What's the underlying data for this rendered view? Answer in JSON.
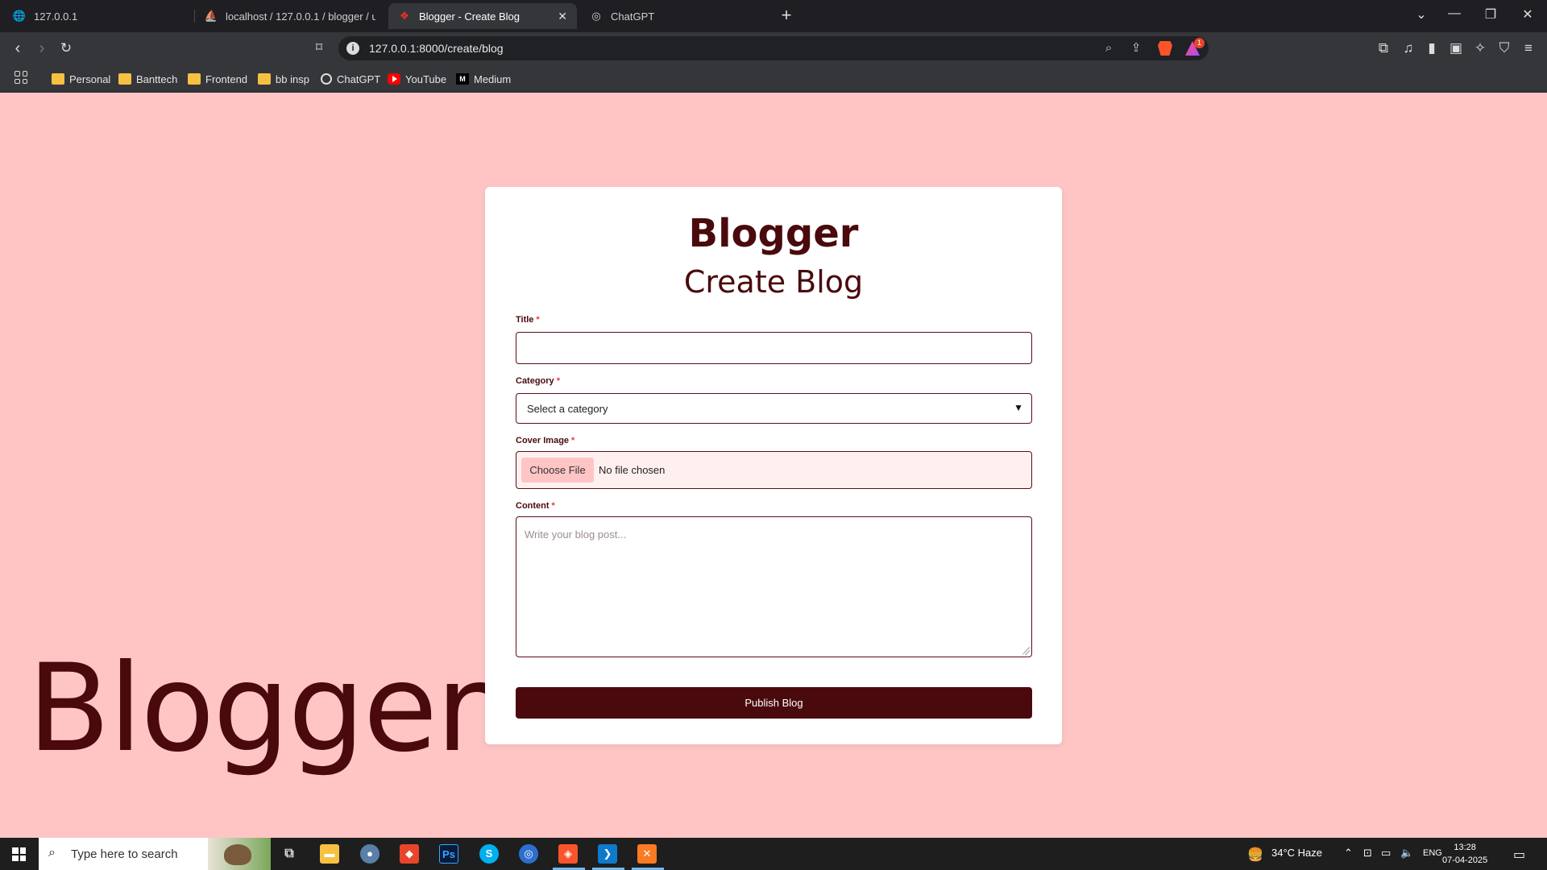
{
  "browser": {
    "tabs": [
      {
        "title": "127.0.0.1"
      },
      {
        "title": "localhost / 127.0.0.1 / blogger / users"
      },
      {
        "title": "Blogger - Create Blog"
      },
      {
        "title": "ChatGPT"
      }
    ],
    "url": "127.0.0.1:8000/create/blog",
    "rewards_badge": "1",
    "bookmarks": [
      {
        "label": "Personal",
        "icon": "folder-icon"
      },
      {
        "label": "Banttech",
        "icon": "folder-icon"
      },
      {
        "label": "Frontend",
        "icon": "folder-icon"
      },
      {
        "label": "bb insp",
        "icon": "folder-icon"
      },
      {
        "label": "ChatGPT",
        "icon": "chatgpt-icon"
      },
      {
        "label": "YouTube",
        "icon": "youtube-icon"
      },
      {
        "label": "Medium",
        "icon": "medium-icon"
      }
    ]
  },
  "page": {
    "background_word": "Blogger",
    "brand": "Blogger",
    "heading": "Create Blog",
    "form": {
      "title_label": "Title",
      "title_value": "",
      "category_label": "Category",
      "category_selected": "Select a category",
      "cover_label": "Cover Image",
      "choose_file": "Choose File",
      "file_status": "No file chosen",
      "content_label": "Content",
      "content_placeholder": "Write your blog post...",
      "required_mark": "*",
      "submit_label": "Publish Blog"
    },
    "colors": {
      "background": "#ffc5c5",
      "accent": "#4a0a0d",
      "card": "#ffffff"
    }
  },
  "taskbar": {
    "search_placeholder": "Type here to search",
    "weather": "34°C  Haze",
    "language": "ENG",
    "time": "13:28",
    "date": "07-04-2025"
  }
}
